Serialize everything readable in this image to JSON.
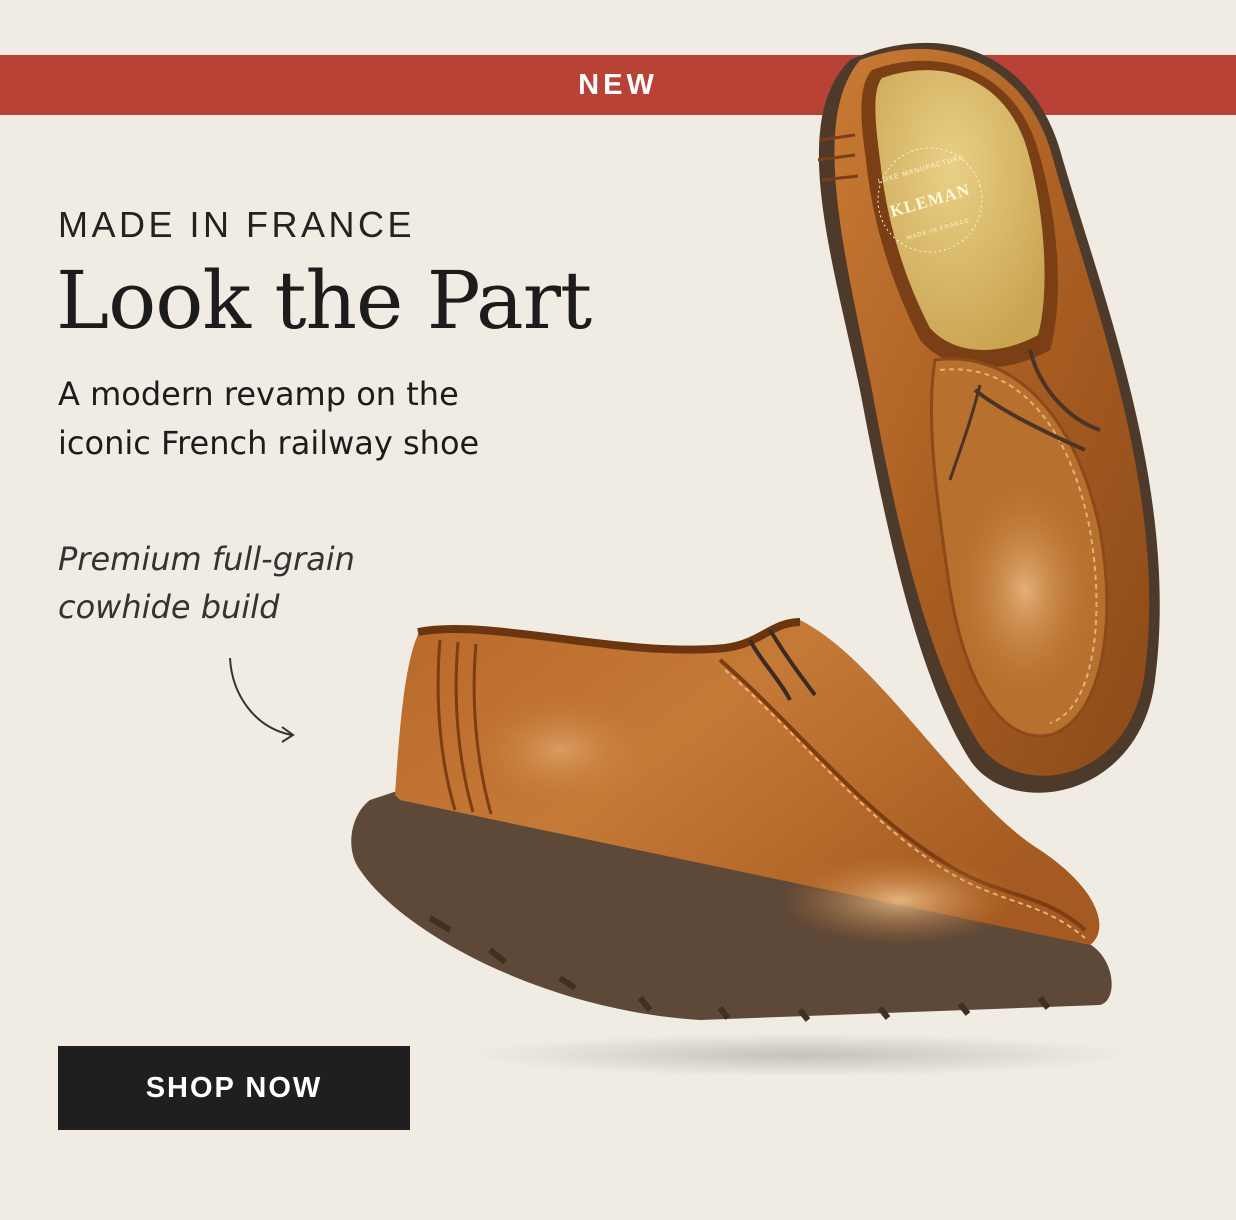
{
  "banner": {
    "label": "NEW"
  },
  "hero": {
    "eyebrow": "MADE IN FRANCE",
    "headline": "Look the Part",
    "subhead": "A modern revamp on the iconic French railway shoe",
    "note": "Premium full-grain cowhide build"
  },
  "insole_logo": {
    "brand": "KLEMAN",
    "top_text": "LUXE MANUFACTURE",
    "bottom_text": "MADE IN FRANCE"
  },
  "cta": {
    "label": "SHOP NOW"
  },
  "colors": {
    "background": "#f1ece3",
    "banner": "#b94236",
    "button": "#1f1f1f",
    "leather": "#b4692a",
    "sole": "#5e4837"
  }
}
